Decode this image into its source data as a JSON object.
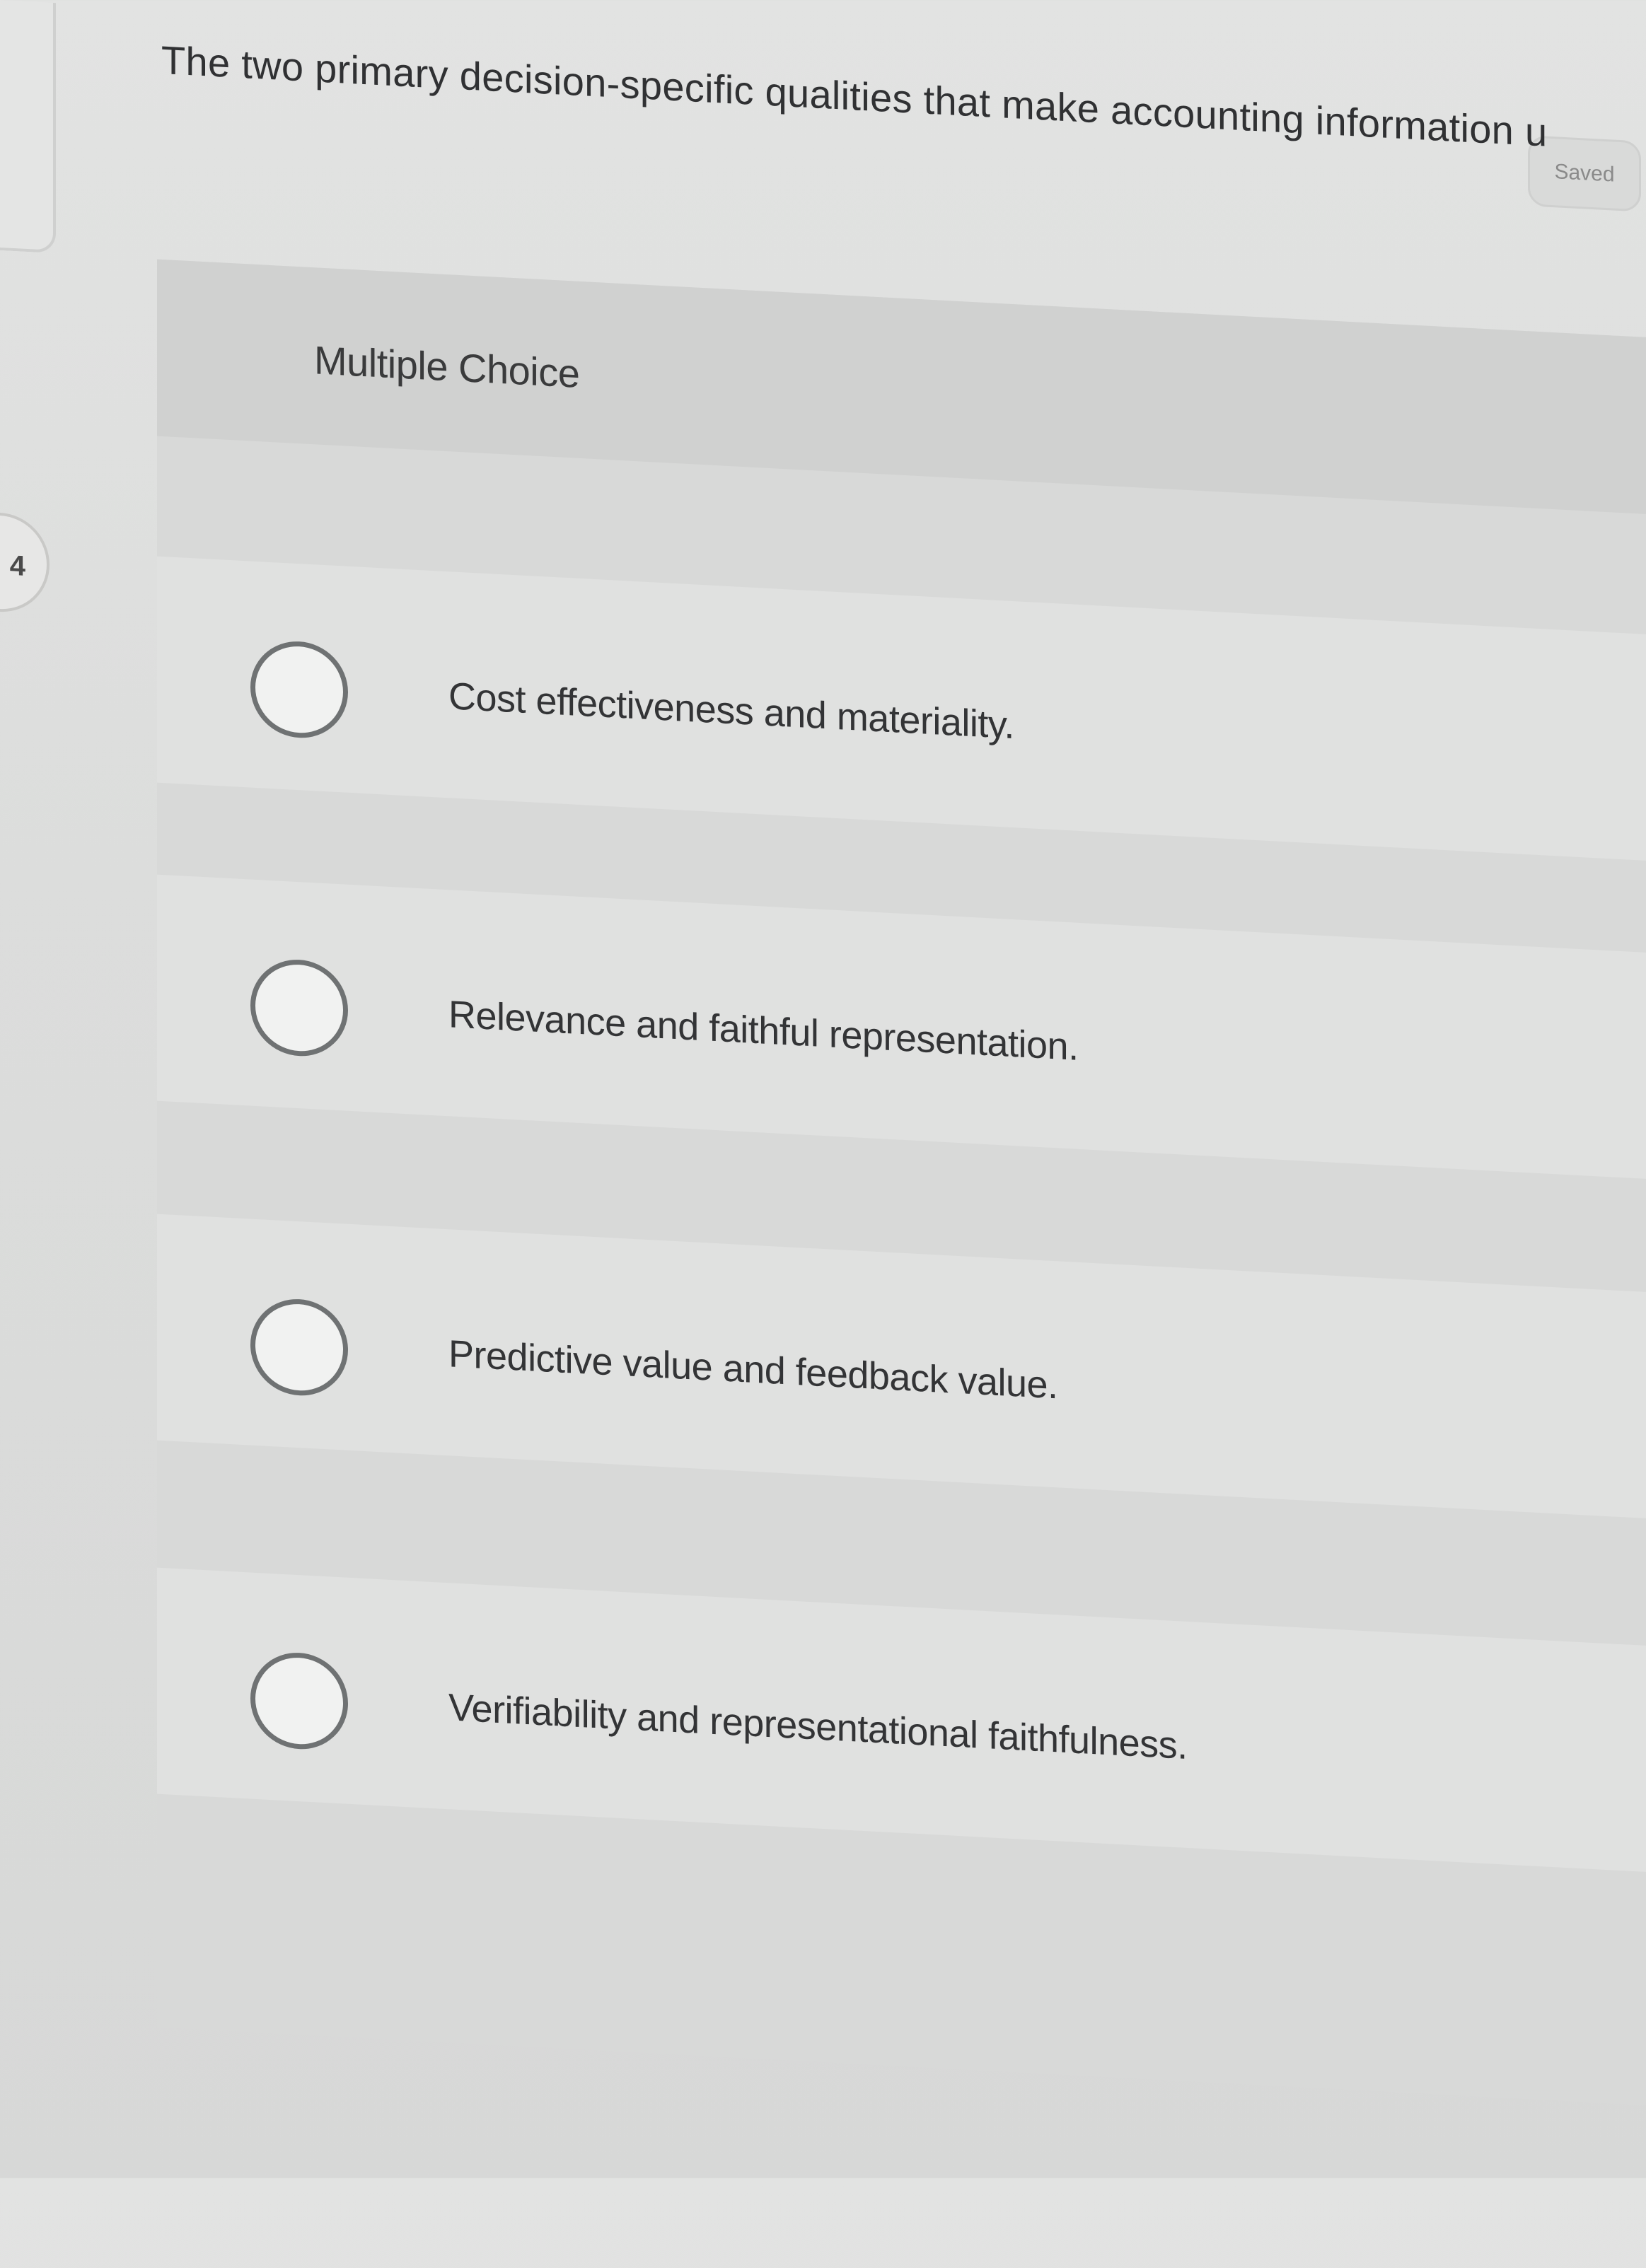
{
  "status": {
    "saved_label": "Saved"
  },
  "question": {
    "number": "4",
    "text": "The two primary decision-specific qualities that make accounting information u"
  },
  "answer_section": {
    "type_label": "Multiple Choice",
    "choices": [
      {
        "label": "Cost effectiveness and materiality."
      },
      {
        "label": "Relevance and faithful representation."
      },
      {
        "label": "Predictive value and feedback value."
      },
      {
        "label": "Verifiability and representational faithfulness."
      }
    ]
  }
}
